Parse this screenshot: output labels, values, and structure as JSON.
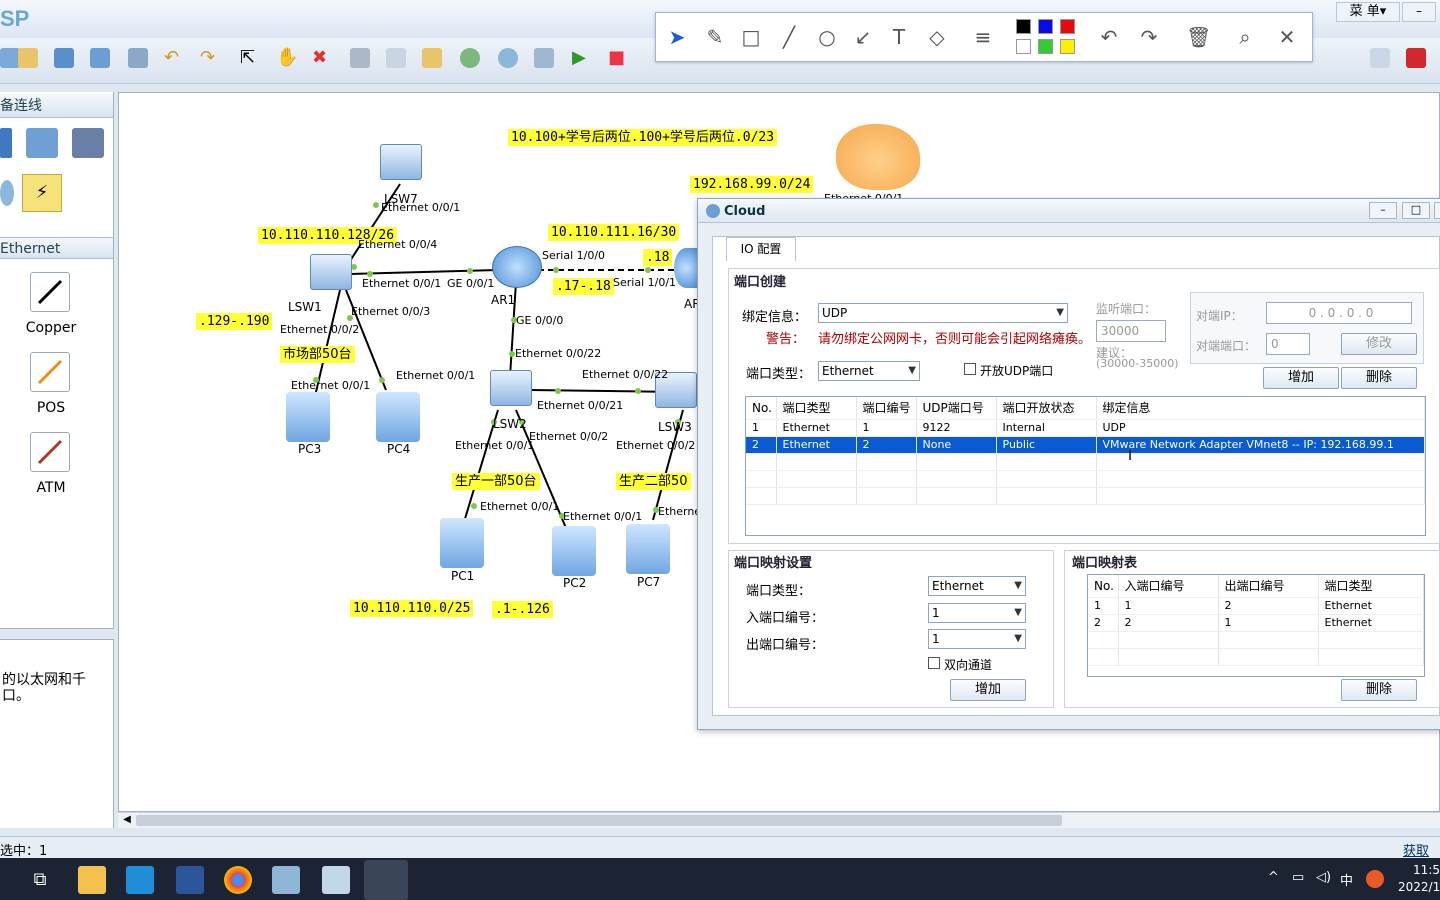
{
  "app": {
    "logo": "SP",
    "menu_label": "菜 单▾",
    "minimize": "–"
  },
  "drawbar": {
    "colors": [
      "#000000",
      "#0a0ae6",
      "#e60a0a",
      "#ffffff",
      "#33cc33",
      "#ffee00"
    ]
  },
  "left_panel": {
    "header": "备连线",
    "eth_header": "Ethernet",
    "cables": [
      {
        "label": "Copper"
      },
      {
        "label": "POS"
      },
      {
        "label": "ATM"
      }
    ],
    "description": "的以太网和千口。"
  },
  "topology": {
    "notes": {
      "n1": "10.100+学号后两位.100+学号后两位.0/23",
      "n2": "192.168.99.0/24",
      "n3": "10.110.110.128/26",
      "n4": "10.110.111.16/30",
      "n5": ".18",
      "n6": ".17-.18",
      "n7": ".129-.190",
      "n8": "市场部50台",
      "n9": "生产一部50台",
      "n10": "生产二部50",
      "n11": "10.110.110.0/25",
      "n12": ".1-.126"
    },
    "devices": {
      "lsw7": "LSW7",
      "lsw1": "LSW1",
      "ar1": "AR1",
      "ar2": "AR",
      "lsw2": "LSW2",
      "lsw3": "LSW3",
      "pc3": "PC3",
      "pc4": "PC4",
      "pc1": "PC1",
      "pc2": "PC2",
      "pc7": "PC7"
    },
    "ifaces": {
      "i1": "Ethernet 0/0/1",
      "i2": "Ethernet 0/0/4",
      "i3": "Ethernet 0/0/1",
      "i4": "GE 0/0/1",
      "i5": "Serial 1/0/0",
      "i6": "Serial 1/0/1",
      "i7": "Ethernet 0/0/3",
      "i8": "Ethernet 0/0/2",
      "i9": "GE 0/0/0",
      "i10": "Ethernet 0/0/22",
      "i11": "Ethernet 0/0/1",
      "i12": "Ethernet 0/0/1",
      "i13": "Ethernet 0/0/22",
      "i14": "Ethernet 0/0/21",
      "i15": "Ethernet 0/0/1",
      "i16": "Ethernet 0/0/2",
      "i17": "Ethernet 0/0/2",
      "i18": "Ethernet 0/0/1",
      "i19": "Ethernet 0/0/1",
      "i20": "Etherne",
      "i21": "Ethernet 0/0/1"
    }
  },
  "cloud": {
    "title": "Cloud",
    "tab": "IO 配置",
    "port_create": {
      "title": "端口创建",
      "bind_label": "绑定信息：",
      "bind_value": "UDP",
      "warn_label": "警告：",
      "warn_text": "请勿绑定公网网卡，否则可能会引起网络瘫痪。",
      "listen_label": "监听端口：",
      "listen_value": "30000",
      "suggest": "建议：",
      "suggest_range": "(30000-35000)",
      "peer_ip_label": "对端IP：",
      "peer_ip": "0 . 0 . 0 . 0",
      "peer_port_label": "对端端口：",
      "peer_port": "0",
      "modify": "修改",
      "port_type_label": "端口类型：",
      "port_type": "Ethernet",
      "udp_open": "开放UDP端口",
      "add": "增加",
      "delete": "删除",
      "columns": [
        "No.",
        "端口类型",
        "端口编号",
        "UDP端口号",
        "端口开放状态",
        "绑定信息"
      ],
      "rows": [
        [
          "1",
          "Ethernet",
          "1",
          "9122",
          "Internal",
          "UDP"
        ],
        [
          "2",
          "Ethernet",
          "2",
          "None",
          "Public",
          "VMware Network Adapter VMnet8 -- IP: 192.168.99.1"
        ]
      ]
    },
    "mapping": {
      "title": "端口映射设置",
      "type_label": "端口类型：",
      "type_value": "Ethernet",
      "in_label": "入端口编号：",
      "in_value": "1",
      "out_label": "出端口编号：",
      "out_value": "1",
      "bidir": "双向通道",
      "add": "增加"
    },
    "map_table": {
      "title": "端口映射表",
      "columns": [
        "No.",
        "入端口编号",
        "出端口编号",
        "端口类型"
      ],
      "rows": [
        [
          "1",
          "1",
          "2",
          "Ethernet"
        ],
        [
          "2",
          "2",
          "1",
          "Ethernet"
        ]
      ],
      "delete": "删除"
    }
  },
  "status": {
    "left": "选中：1",
    "right": "获取帮"
  },
  "taskbar": {
    "ime": "中",
    "time": "11:5",
    "date": "2022/1"
  }
}
